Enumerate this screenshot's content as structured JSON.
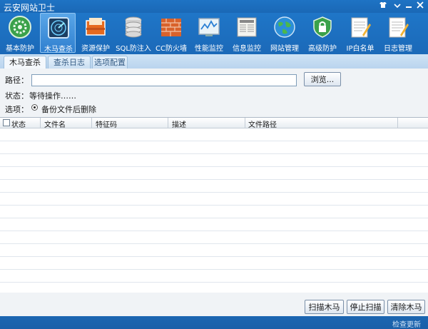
{
  "window": {
    "title": "云安网站卫士",
    "controls": [
      "shirt-icon",
      "chevron-down-icon",
      "minimize-icon",
      "close-icon"
    ]
  },
  "toolbar": {
    "items": [
      {
        "label": "基本防护",
        "icon": "shield-gear-icon",
        "active": false
      },
      {
        "label": "木马查杀",
        "icon": "radar-icon",
        "active": true
      },
      {
        "label": "资源保护",
        "icon": "folder-box-icon",
        "active": false
      },
      {
        "label": "SQL防注入",
        "icon": "database-icon",
        "active": false
      },
      {
        "label": "CC防火墙",
        "icon": "firewall-icon",
        "active": false
      },
      {
        "label": "性能监控",
        "icon": "monitor-graph-icon",
        "active": false
      },
      {
        "label": "信息监控",
        "icon": "newspaper-icon",
        "active": false
      },
      {
        "label": "网站管理",
        "icon": "globe-icon",
        "active": false
      },
      {
        "label": "高级防护",
        "icon": "lock-shield-icon",
        "active": false
      },
      {
        "label": "IP白名单",
        "icon": "notepad-pencil-icon",
        "active": false
      },
      {
        "label": "日志管理",
        "icon": "notepad-pencil-icon",
        "active": false
      }
    ]
  },
  "tabs": [
    "木马查杀",
    "查杀日志",
    "选项配置"
  ],
  "form": {
    "path_label": "路径：",
    "path_value": "",
    "browse_label": "浏览...",
    "status_label": "状态：",
    "status_value": "等待操作……",
    "option_label": "选项：",
    "option_radio_label": "备份文件后删除"
  },
  "table": {
    "columns": [
      "状态",
      "文件名",
      "特征码",
      "描述",
      "文件路径"
    ],
    "rows": []
  },
  "actions": {
    "scan": "扫描木马",
    "stop": "停止扫描",
    "clear": "清除木马"
  },
  "footer": {
    "check_update": "检查更新"
  }
}
